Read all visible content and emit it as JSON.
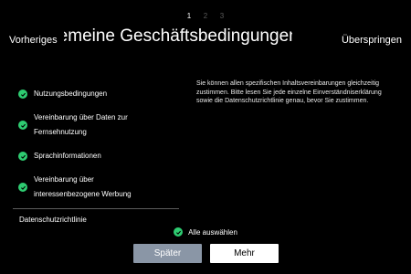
{
  "pager": {
    "pages": [
      "1",
      "2",
      "3"
    ],
    "active_index": 0
  },
  "header": {
    "title": "Allgemeine Geschäftsbedingungen",
    "prev_label": "Vorheriges",
    "skip_label": "Überspringen"
  },
  "agreements": [
    {
      "label": "Nutzungsbedingungen",
      "checked": true
    },
    {
      "label": "Vereinbarung über Daten zur Fernsehnutzung",
      "checked": true
    },
    {
      "label": "Sprachinformationen",
      "checked": true
    },
    {
      "label": "Vereinbarung über interessenbezogene Werbung",
      "checked": true
    }
  ],
  "privacy_label": "Datenschutzrichtlinie",
  "description": "Sie können allen spezifischen Inhaltsvereinbarungen gleichzeitig zustimmen. Bitte lesen Sie jede einzelne Einverständniserklärung sowie die Datenschutzrichtlinie genau, bevor Sie zustimmen.",
  "select_all": {
    "label": "Alle auswählen",
    "checked": true
  },
  "buttons": {
    "later_label": "Später",
    "more_label": "Mehr"
  },
  "colors": {
    "check": "#2ecc71",
    "later_button": "#8a96a6",
    "more_button": "#ffffff"
  }
}
